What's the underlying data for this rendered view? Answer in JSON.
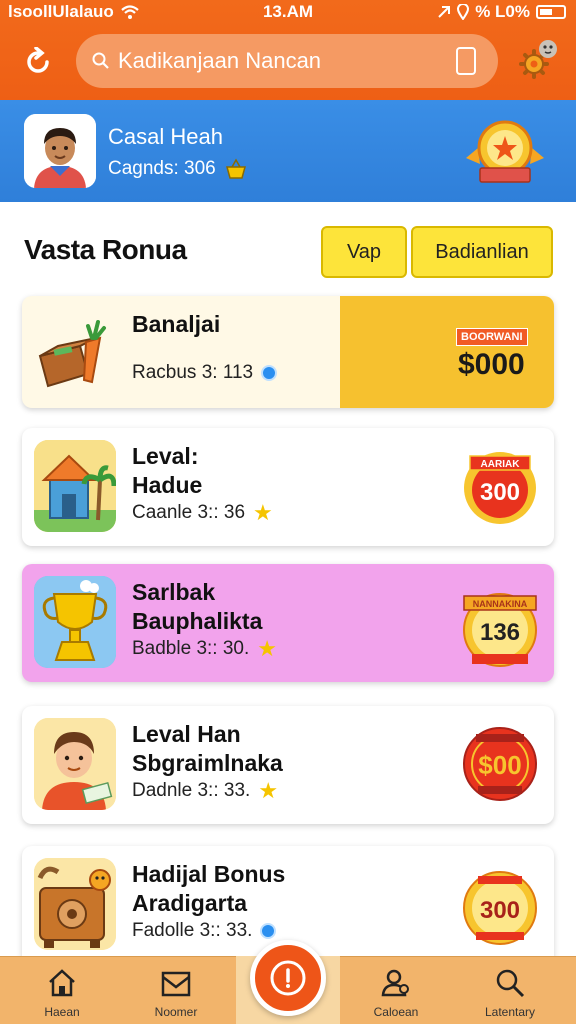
{
  "status": {
    "carrier": "lsoollUlalauo",
    "time": "13.AM",
    "battery": "% L0%"
  },
  "header": {
    "search_placeholder": "Kadikanjaan Nancan"
  },
  "profile": {
    "name": "Casal Heah",
    "coins": "Cagnds: 306"
  },
  "section": {
    "title": "Vasta Ronua",
    "tab1": "Vap",
    "tab2": "Badianlian"
  },
  "cards": [
    {
      "title": "Banaljai",
      "subtitle": "Racbus 3: 113",
      "tag": "BOORWANI",
      "amount": "$000"
    },
    {
      "title_line1": "Leval:",
      "title_line2": "Hadue",
      "subtitle": "Caanle 3:: 36",
      "badge_tag": "AARIAK",
      "amount": "300"
    },
    {
      "title_line1": "Sarlbak",
      "title_line2": "Bauphalikta",
      "subtitle": "Badble 3:: 30.",
      "badge_tag": "NANNAKINA",
      "amount": "136"
    },
    {
      "title_line1": "Leval Han",
      "title_line2": "Sbgraimlnaka",
      "subtitle": "Dadnle 3:: 33.",
      "amount": "$00"
    },
    {
      "title_line1": "Hadijal Bonus",
      "title_line2": "Aradigarta",
      "subtitle": "Fadolle 3:: 33.",
      "amount": "300"
    }
  ],
  "nav": {
    "home": "Haean",
    "news": "Noomer",
    "profile": "Caloean",
    "search": "Latentary"
  },
  "colors": {
    "header": "#f26a1b",
    "profile_bar": "#3a8ee6",
    "tab_yellow": "#fde43a",
    "card_pink": "#f2a3ec",
    "gold": "#f6c12f",
    "nav": "#f2b46b"
  }
}
